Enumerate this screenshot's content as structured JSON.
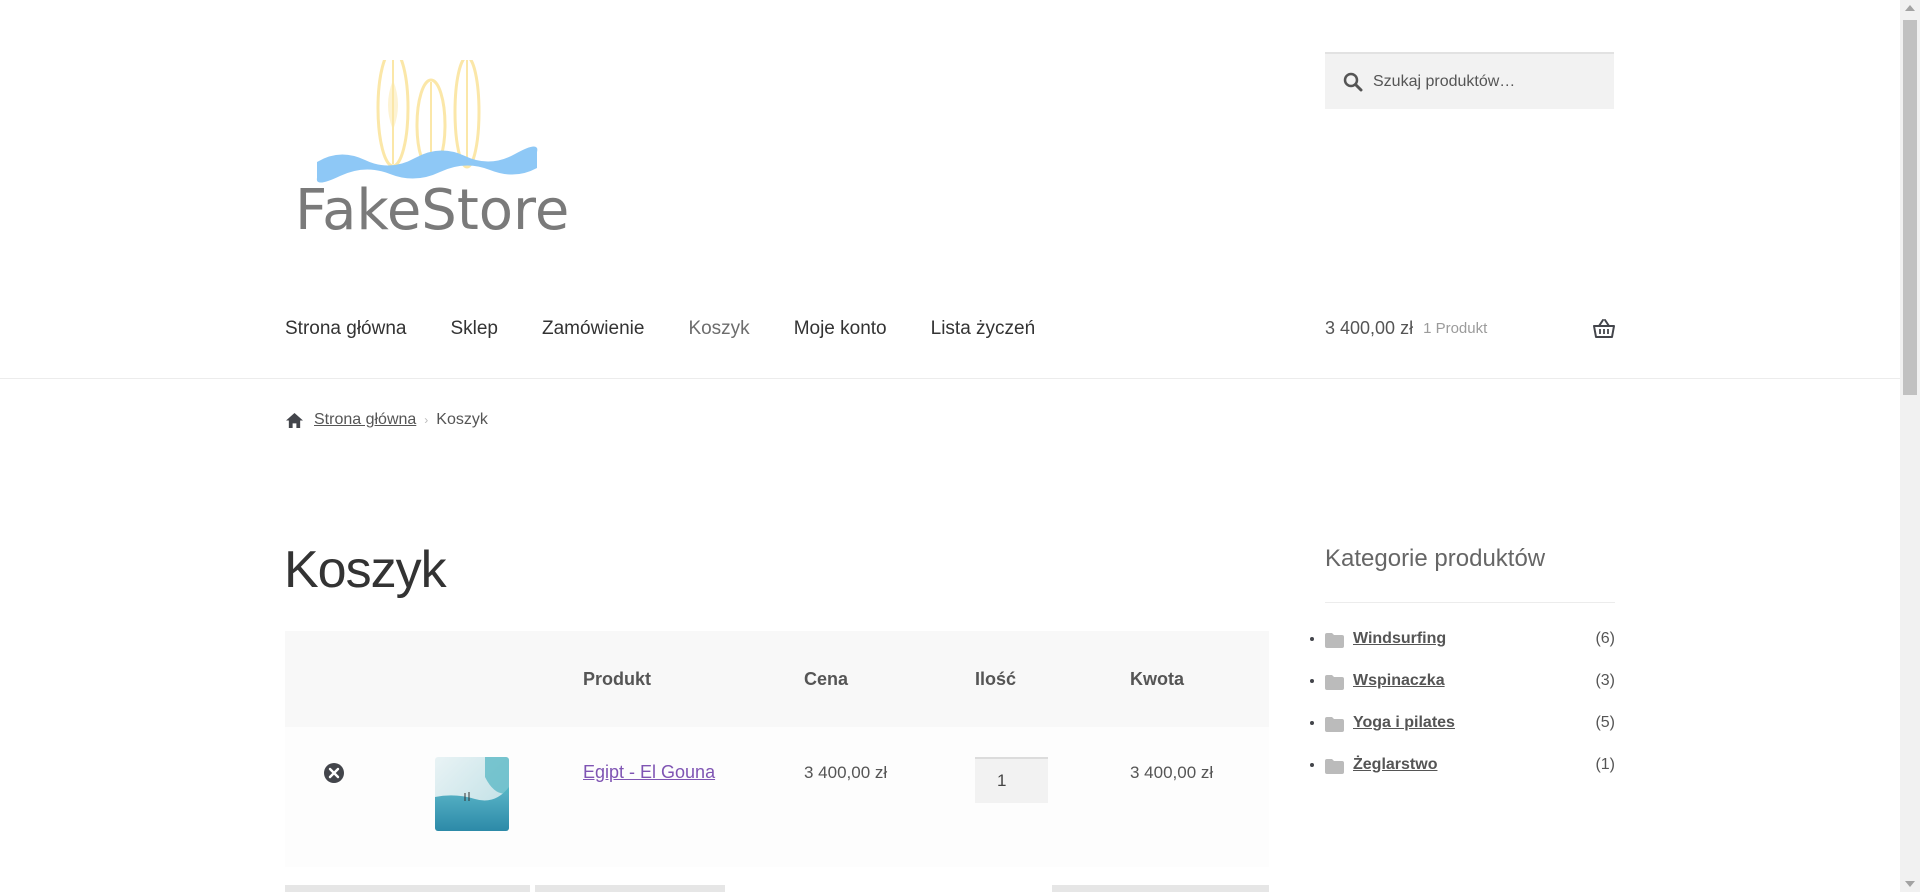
{
  "header": {
    "logo_text": "FakeStore",
    "search_placeholder": "Szukaj produktów…"
  },
  "nav": {
    "items": [
      {
        "label": "Strona główna"
      },
      {
        "label": "Sklep"
      },
      {
        "label": "Zamówienie"
      },
      {
        "label": "Koszyk",
        "active": true
      },
      {
        "label": "Moje konto"
      },
      {
        "label": "Lista życzeń"
      }
    ]
  },
  "cart_summary": {
    "amount": "3 400,00 zł",
    "count": "1 Produkt"
  },
  "breadcrumb": {
    "home": "Strona główna",
    "current": "Koszyk"
  },
  "page_title": "Koszyk",
  "cart_table": {
    "headers": {
      "product": "Produkt",
      "price": "Cena",
      "quantity": "Ilość",
      "subtotal": "Kwota"
    },
    "rows": [
      {
        "product": "Egipt - El Gouna",
        "price": "3 400,00 zł",
        "quantity": "1",
        "subtotal": "3 400,00 zł"
      }
    ]
  },
  "sidebar": {
    "title": "Kategorie produktów",
    "categories": [
      {
        "label": "Windsurfing",
        "count": "(6)"
      },
      {
        "label": "Wspinaczka",
        "count": "(3)"
      },
      {
        "label": "Yoga i pilates",
        "count": "(5)"
      },
      {
        "label": "Żeglarstwo",
        "count": "(1)"
      }
    ]
  },
  "colors": {
    "link_purple": "#7f54b3",
    "logo_wave": "#8ec8f6",
    "logo_boards": "#fbe7a8"
  }
}
